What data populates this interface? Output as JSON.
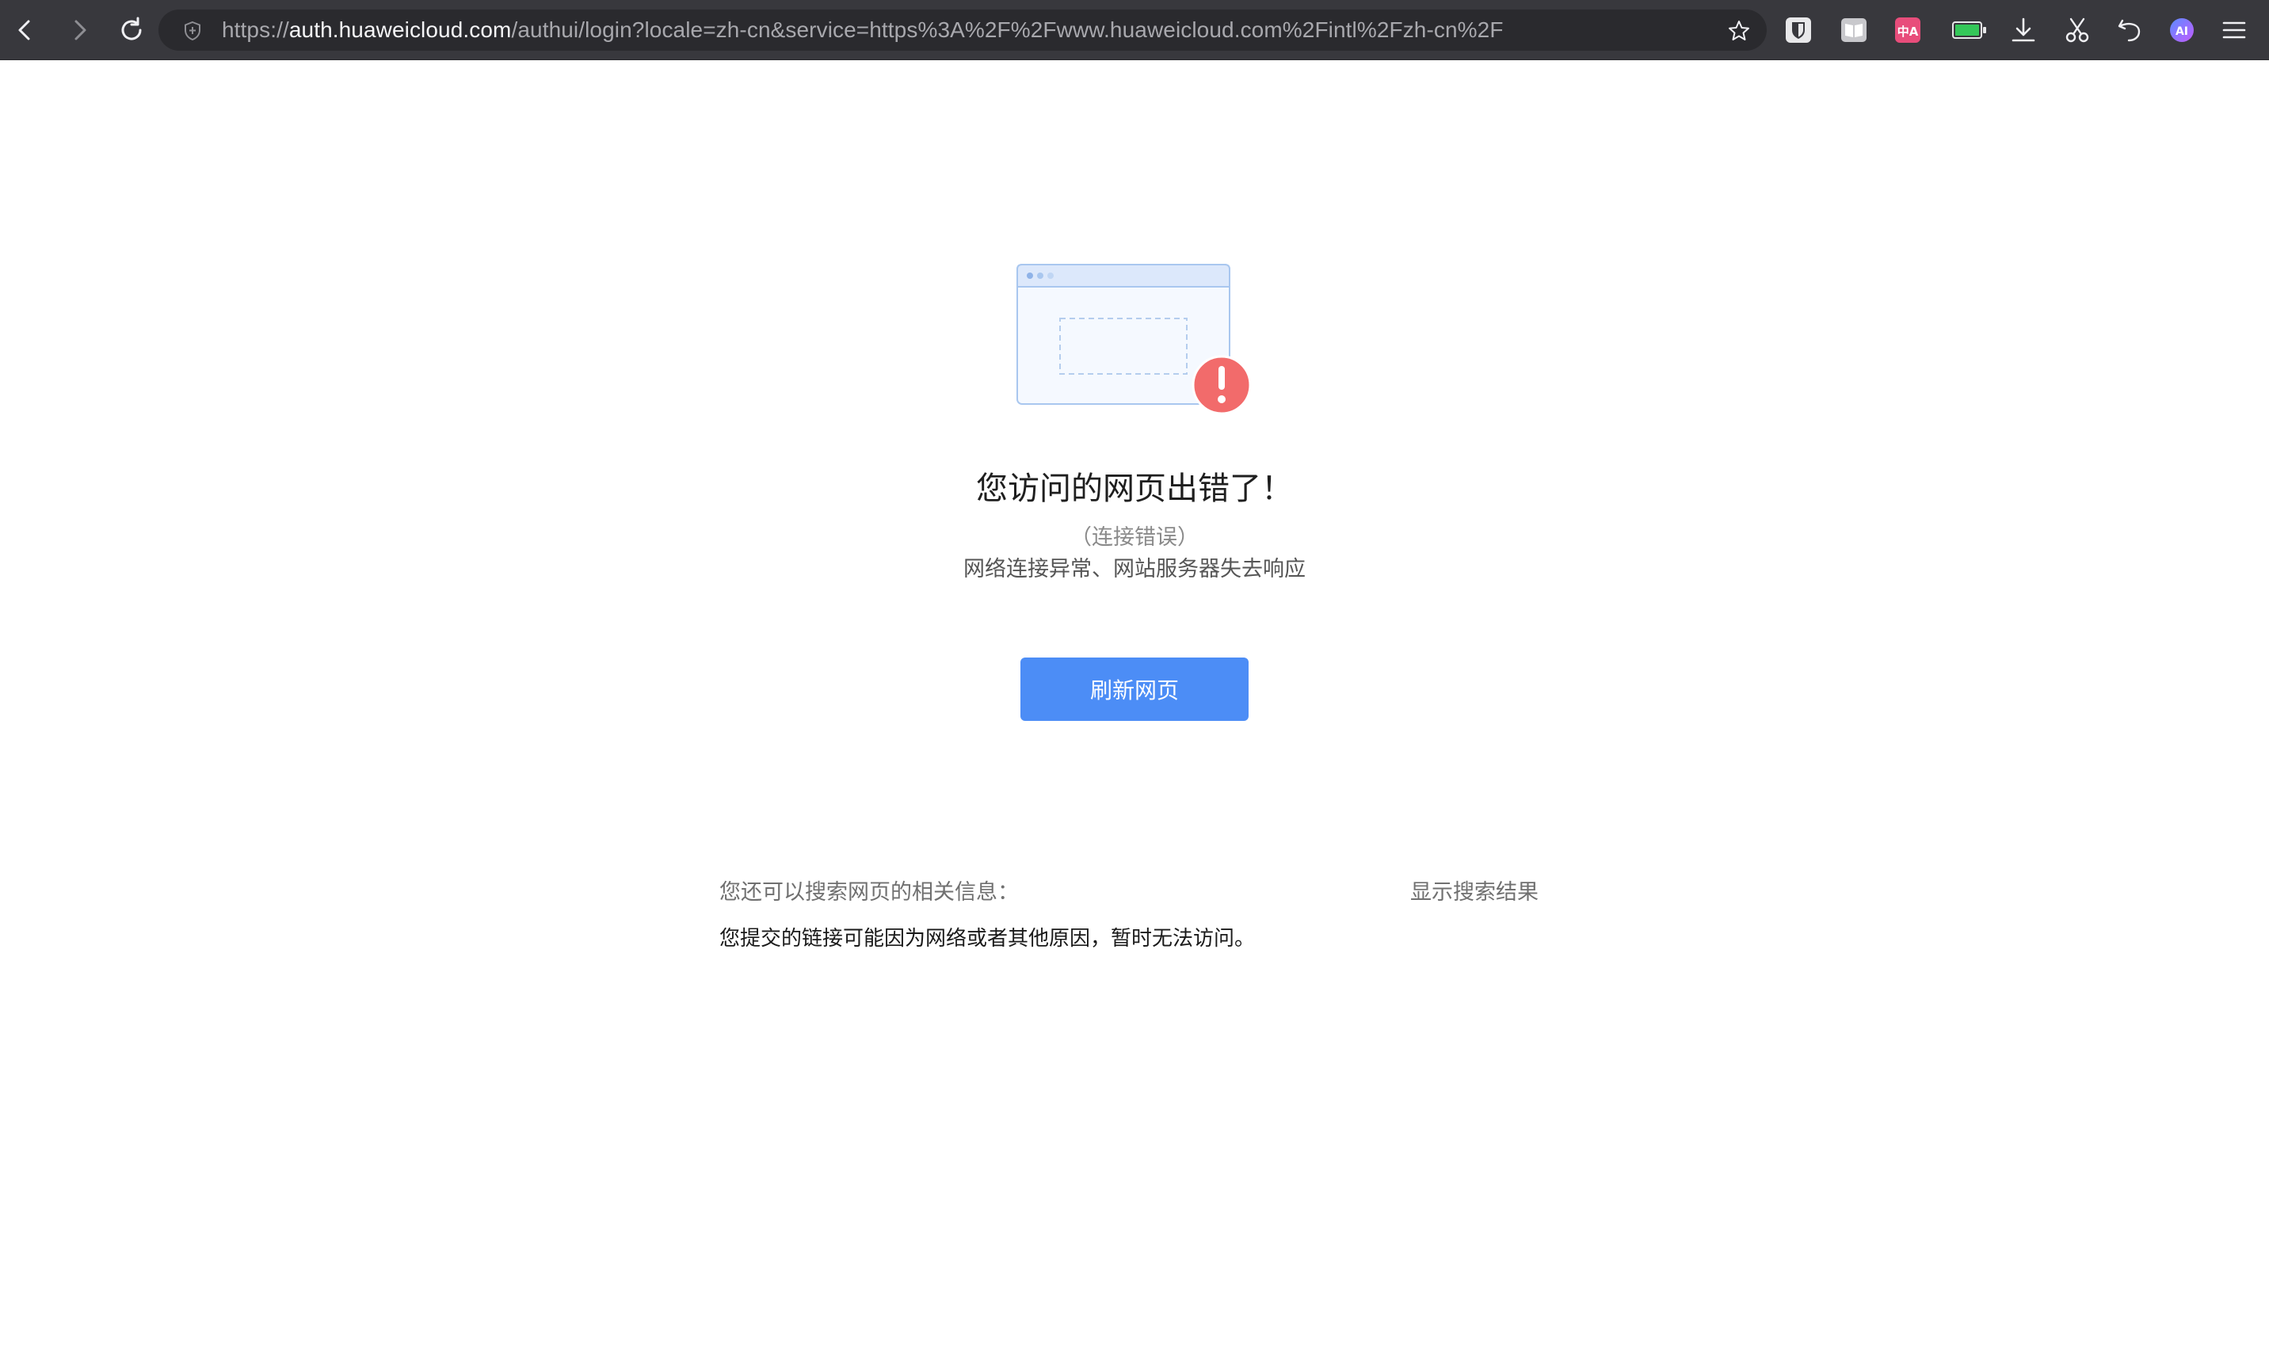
{
  "browser": {
    "url_scheme": "https://",
    "url_host": "auth.huaweicloud.com",
    "url_path": "/authui/login?locale=zh-cn&service=https%3A%2F%2Fwww.huaweicloud.com%2Fintl%2Fzh-cn%2F",
    "toolbar_icons": [
      "bitwarden-icon",
      "reader-icon",
      "translate-icon",
      "battery-icon",
      "download-icon",
      "scissors-icon",
      "undo-icon",
      "ai-assistant-icon",
      "menu-icon"
    ],
    "translate_icon_text": "中A",
    "ai_icon_text": "AI"
  },
  "error_page": {
    "title": "您访问的网页出错了！",
    "code": "（连接错误）",
    "description": "网络连接异常、网站服务器失去响应",
    "refresh_label": "刷新网页",
    "search_hint": "您还可以搜索网页的相关信息：",
    "show_results_label": "显示搜索结果",
    "detail": "您提交的链接可能因为网络或者其他原因，暂时无法访问。"
  },
  "colors": {
    "toolbar_bg": "#38383d",
    "accent": "#4c8df6",
    "error_badge": "#f26b6b"
  }
}
